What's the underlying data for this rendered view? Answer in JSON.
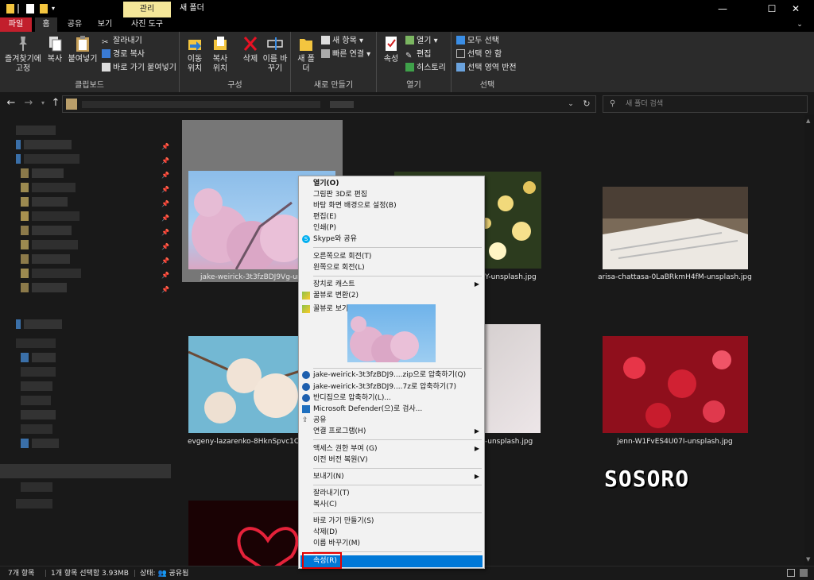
{
  "window": {
    "tool_tab": "관리",
    "title": "새 폴더",
    "min": "—",
    "max": "☐",
    "close": "✕"
  },
  "tabs": {
    "file": "파일",
    "home": "홈",
    "share": "공유",
    "view": "보기",
    "picture_tools": "사진 도구"
  },
  "ribbon": {
    "clipboard": {
      "label": "클립보드",
      "pin": "즐겨찾기에 고정",
      "copy": "복사",
      "paste": "붙여넣기",
      "cut": "잘라내기",
      "copy_path": "경로 복사",
      "paste_shortcut": "바로 가기 붙여넣기"
    },
    "organize": {
      "label": "구성",
      "move_to": "이동 위치",
      "copy_to": "복사 위치",
      "delete": "삭제",
      "rename": "이름 바꾸기"
    },
    "new": {
      "label": "새로 만들기",
      "new_folder": "새 폴더",
      "new_item": "새 항목",
      "easy_access": "빠른 연결"
    },
    "open": {
      "label": "열기",
      "properties": "속성",
      "open": "열기",
      "edit": "편집",
      "history": "히스토리"
    },
    "select": {
      "label": "선택",
      "select_all": "모두 선택",
      "select_none": "선택 안 함",
      "invert": "선택 영역 반전"
    }
  },
  "search": {
    "placeholder": "새 폴더 검색"
  },
  "files": [
    {
      "name": "jake-weirick-3t3fzBDJ9Vg-unsplash.jpg",
      "visible": "jake-weirick-3t3fzBDJ9Vg-unsp"
    },
    {
      "name": "…Y-unsplash.jpg",
      "visible": "Y-unsplash.jpg"
    },
    {
      "name": "arisa-chattasa-0LaBRkmH4fM-unsplash.jpg",
      "visible": "arisa-chattasa-0LaBRkmH4fM-unsplash.jpg"
    },
    {
      "name": "evgeny-lazarenko-8HknSpvc1CU-unsplash.jpg",
      "visible": "evgeny-lazarenko-8HknSpvc1CU-u"
    },
    {
      "name": "…-unsplash.jpg",
      "visible": "-unsplash.jpg"
    },
    {
      "name": "jenn-W1FvES4U07I-unsplash.jpg",
      "visible": "jenn-W1FvES4U07I-unsplash.jpg"
    }
  ],
  "context_menu": {
    "open": "열기(O)",
    "edit_paint3d": "그림판 3D로 편집",
    "set_wallpaper": "바탕 화면 배경으로 설정(B)",
    "edit": "편집(E)",
    "print": "인쇄(P)",
    "skype_share": "Skype와 공유",
    "rotate_right": "오른쪽으로 회전(T)",
    "rotate_left": "왼쪽으로 회전(L)",
    "cast": "장치로 캐스트",
    "honeyview_convert": "꿀뷰로 변환(2)",
    "honeyview_open": "꿀뷰로 보기(3)",
    "zip_compress": "jake-weirick-3t3fzBDJ9....zip으로 압축하기(Q)",
    "sevenz_compress": "jake-weirick-3t3fzBDJ9....7z로 압축하기(7)",
    "bandizip": "반디집으로 압축하기(L)...",
    "defender": "Microsoft Defender(으)로 검사...",
    "share": "공유",
    "open_with": "연결 프로그램(H)",
    "grant_access": "액세스 권한 부여 (G)",
    "restore_versions": "이전 버전 복원(V)",
    "send_to": "보내기(N)",
    "cut": "잘라내기(T)",
    "copy": "복사(C)",
    "create_shortcut": "바로 가기 만들기(S)",
    "delete": "삭제(D)",
    "rename": "이름 바꾸기(M)",
    "properties": "속성(R)"
  },
  "status": {
    "item_count": "7개 항목",
    "selected": "1개 항목 선택함 3.93MB",
    "state": "상태: 👥 공유됨"
  },
  "watermark": "SOSORO",
  "colors": {
    "file_tab": "#c21f2c",
    "tool_tab": "#f5e799",
    "menu_highlight": "#0078d7",
    "annotation_box": "#e60000"
  }
}
